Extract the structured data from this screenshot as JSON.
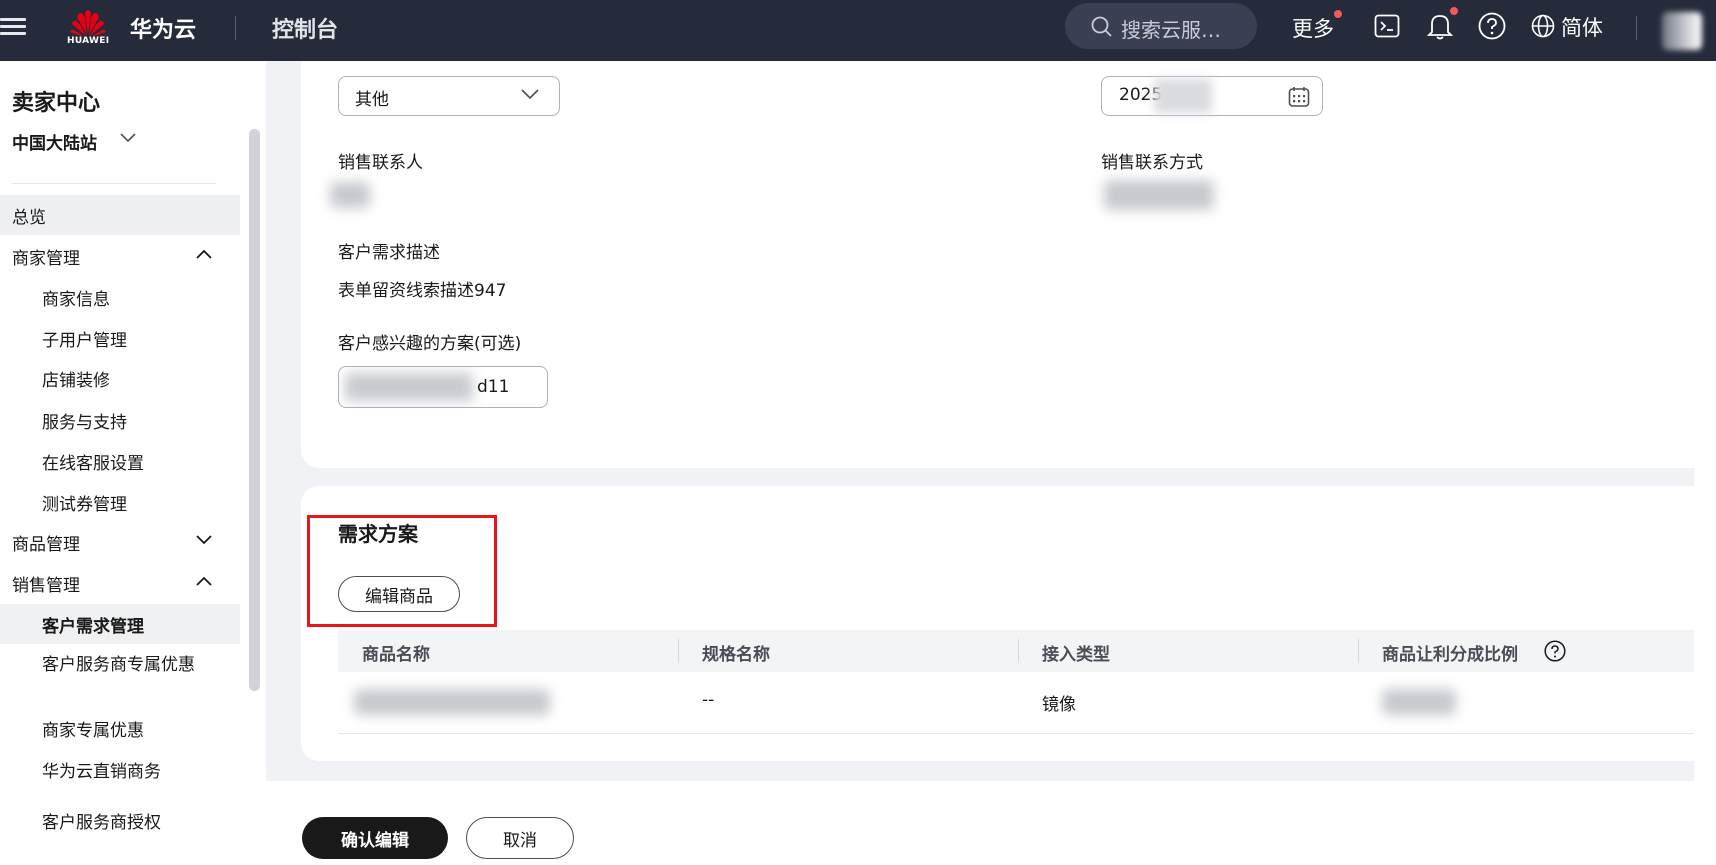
{
  "header": {
    "logo_text": "HUAWEI",
    "brand": "华为云",
    "console": "控制台",
    "search_placeholder": "搜索云服…",
    "more": "更多",
    "language": "简体",
    "icons": [
      "menu-icon",
      "terminal-icon",
      "bell-icon",
      "help-icon",
      "globe-icon"
    ]
  },
  "sidebar": {
    "title": "卖家中心",
    "region": "中国大陆站",
    "items": [
      {
        "label": "总览"
      },
      {
        "label": "商家管理"
      },
      {
        "label": "商家信息"
      },
      {
        "label": "子用户管理"
      },
      {
        "label": "店铺装修"
      },
      {
        "label": "服务与支持"
      },
      {
        "label": "在线客服设置"
      },
      {
        "label": "测试券管理"
      },
      {
        "label": "商品管理"
      },
      {
        "label": "销售管理"
      },
      {
        "label": "客户需求管理"
      },
      {
        "label": "客户服务商专属优惠"
      },
      {
        "label": "商家专属优惠"
      },
      {
        "label": "华为云直销商务"
      },
      {
        "label": "客户服务商授权"
      }
    ]
  },
  "form": {
    "category_value": "其他",
    "date_value": "2025",
    "sales_contact_label": "销售联系人",
    "sales_phone_label": "销售联系方式",
    "requirement_label": "客户需求描述",
    "requirement_value": "表单留资线索描述947",
    "solution_label": "客户感兴趣的方案(可选)",
    "solution_value": "d11"
  },
  "solution": {
    "title": "需求方案",
    "edit_button": "编辑商品",
    "columns": [
      "商品名称",
      "规格名称",
      "接入类型",
      "商品让利分成比例"
    ],
    "rows": [
      {
        "spec": "--",
        "access_type": "镜像"
      }
    ]
  },
  "footer": {
    "confirm": "确认编辑",
    "cancel": "取消"
  },
  "colors": {
    "topbar": "#252b3a",
    "highlight_box": "#e8161b",
    "primary_button": "#191919",
    "logo_red": "#e60012"
  }
}
